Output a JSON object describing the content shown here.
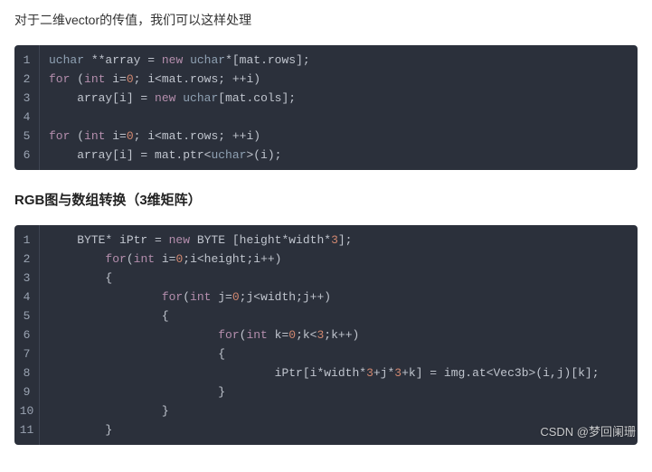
{
  "intro": "对于二维vector的传值，我们可以这样处理",
  "heading": "RGB图与数组转换（3维矩阵）",
  "watermark": "CSDN @梦回阑珊",
  "code1": {
    "lines": [
      {
        "n": "1",
        "tokens": [
          {
            "t": "uchar",
            "c": "type"
          },
          {
            "t": " **array = ",
            "c": "op"
          },
          {
            "t": "new",
            "c": "kw"
          },
          {
            "t": " ",
            "c": "op"
          },
          {
            "t": "uchar",
            "c": "type"
          },
          {
            "t": "*[mat.rows];",
            "c": "op"
          }
        ]
      },
      {
        "n": "2",
        "tokens": [
          {
            "t": "for",
            "c": "kw"
          },
          {
            "t": " (",
            "c": "op"
          },
          {
            "t": "int",
            "c": "kw"
          },
          {
            "t": " i=",
            "c": "op"
          },
          {
            "t": "0",
            "c": "num"
          },
          {
            "t": "; i<mat.rows; ++i)",
            "c": "op"
          }
        ]
      },
      {
        "n": "3",
        "tokens": [
          {
            "t": "    array[i] = ",
            "c": "op"
          },
          {
            "t": "new",
            "c": "kw"
          },
          {
            "t": " ",
            "c": "op"
          },
          {
            "t": "uchar",
            "c": "type"
          },
          {
            "t": "[mat.cols];",
            "c": "op"
          }
        ]
      },
      {
        "n": "4",
        "tokens": [
          {
            "t": " ",
            "c": "op"
          }
        ]
      },
      {
        "n": "5",
        "tokens": [
          {
            "t": "for",
            "c": "kw"
          },
          {
            "t": " (",
            "c": "op"
          },
          {
            "t": "int",
            "c": "kw"
          },
          {
            "t": " i=",
            "c": "op"
          },
          {
            "t": "0",
            "c": "num"
          },
          {
            "t": "; i<mat.rows; ++i)",
            "c": "op"
          }
        ]
      },
      {
        "n": "6",
        "tokens": [
          {
            "t": "    array[i] = mat.ptr<",
            "c": "op"
          },
          {
            "t": "uchar",
            "c": "type"
          },
          {
            "t": ">(i);",
            "c": "op"
          }
        ]
      }
    ]
  },
  "code2": {
    "lines": [
      {
        "n": "1",
        "tokens": [
          {
            "t": "    BYTE* iPtr = ",
            "c": "op"
          },
          {
            "t": "new",
            "c": "kw"
          },
          {
            "t": " BYTE [height*width*",
            "c": "op"
          },
          {
            "t": "3",
            "c": "num"
          },
          {
            "t": "];",
            "c": "op"
          }
        ]
      },
      {
        "n": "2",
        "tokens": [
          {
            "t": "        ",
            "c": "op"
          },
          {
            "t": "for",
            "c": "kw"
          },
          {
            "t": "(",
            "c": "op"
          },
          {
            "t": "int",
            "c": "kw"
          },
          {
            "t": " i=",
            "c": "op"
          },
          {
            "t": "0",
            "c": "num"
          },
          {
            "t": ";i<height;i++)",
            "c": "op"
          }
        ]
      },
      {
        "n": "3",
        "tokens": [
          {
            "t": "        {",
            "c": "op"
          }
        ]
      },
      {
        "n": "4",
        "tokens": [
          {
            "t": "                ",
            "c": "op"
          },
          {
            "t": "for",
            "c": "kw"
          },
          {
            "t": "(",
            "c": "op"
          },
          {
            "t": "int",
            "c": "kw"
          },
          {
            "t": " j=",
            "c": "op"
          },
          {
            "t": "0",
            "c": "num"
          },
          {
            "t": ";j<width;j++)",
            "c": "op"
          }
        ]
      },
      {
        "n": "5",
        "tokens": [
          {
            "t": "                {",
            "c": "op"
          }
        ]
      },
      {
        "n": "6",
        "tokens": [
          {
            "t": "                        ",
            "c": "op"
          },
          {
            "t": "for",
            "c": "kw"
          },
          {
            "t": "(",
            "c": "op"
          },
          {
            "t": "int",
            "c": "kw"
          },
          {
            "t": " k=",
            "c": "op"
          },
          {
            "t": "0",
            "c": "num"
          },
          {
            "t": ";k<",
            "c": "op"
          },
          {
            "t": "3",
            "c": "num"
          },
          {
            "t": ";k++)",
            "c": "op"
          }
        ]
      },
      {
        "n": "7",
        "tokens": [
          {
            "t": "                        {",
            "c": "op"
          }
        ]
      },
      {
        "n": "8",
        "tokens": [
          {
            "t": "                                iPtr[i*width*",
            "c": "op"
          },
          {
            "t": "3",
            "c": "num"
          },
          {
            "t": "+j*",
            "c": "op"
          },
          {
            "t": "3",
            "c": "num"
          },
          {
            "t": "+k] = img.at<Vec3b>(i,j)[k];",
            "c": "op"
          }
        ]
      },
      {
        "n": "9",
        "tokens": [
          {
            "t": "                        }",
            "c": "op"
          }
        ]
      },
      {
        "n": "10",
        "tokens": [
          {
            "t": "                }",
            "c": "op"
          }
        ]
      },
      {
        "n": "11",
        "tokens": [
          {
            "t": "        }",
            "c": "op"
          }
        ]
      }
    ]
  }
}
